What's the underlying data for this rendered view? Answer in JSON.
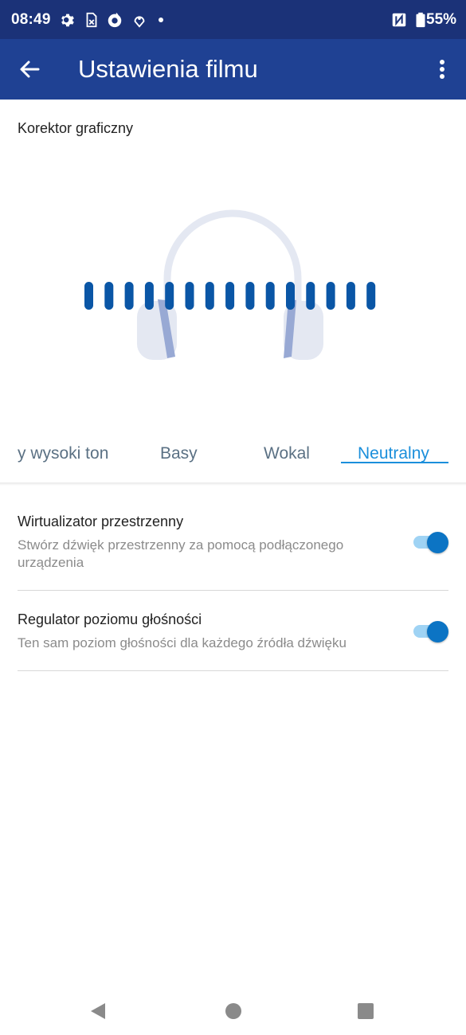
{
  "status_bar": {
    "time": "08:49",
    "icons": [
      "settings-icon",
      "sim-card-icon",
      "firefox-icon",
      "location-pin-icon",
      "notification-dot-icon",
      "nfc-icon",
      "battery-icon"
    ],
    "battery_percent": "55%"
  },
  "app_bar": {
    "title": "Ustawienia filmu",
    "back_icon": "arrow-left-icon",
    "menu_icon": "more-vertical-icon",
    "background_color": "#1f4193"
  },
  "equalizer": {
    "section_label": "Korektor graficzny",
    "tabs": [
      {
        "label": "y wysoki ton",
        "active": false
      },
      {
        "label": "Basy",
        "active": false
      },
      {
        "label": "Wokal",
        "active": false
      },
      {
        "label": "Neutralny",
        "active": true
      }
    ],
    "accent_color": "#1b8fdb"
  },
  "settings": [
    {
      "title": "Wirtualizator przestrzenny",
      "subtitle": "Stwórz dźwięk przestrzenny za pomocą podłączonego urządzenia",
      "enabled": true
    },
    {
      "title": "Regulator poziomu głośności",
      "subtitle": "Ten sam poziom głośności dla każdego źródła dźwięku",
      "enabled": true
    }
  ],
  "nav_bar": {
    "icons": [
      "back-triangle-icon",
      "home-circle-icon",
      "recents-square-icon"
    ]
  }
}
